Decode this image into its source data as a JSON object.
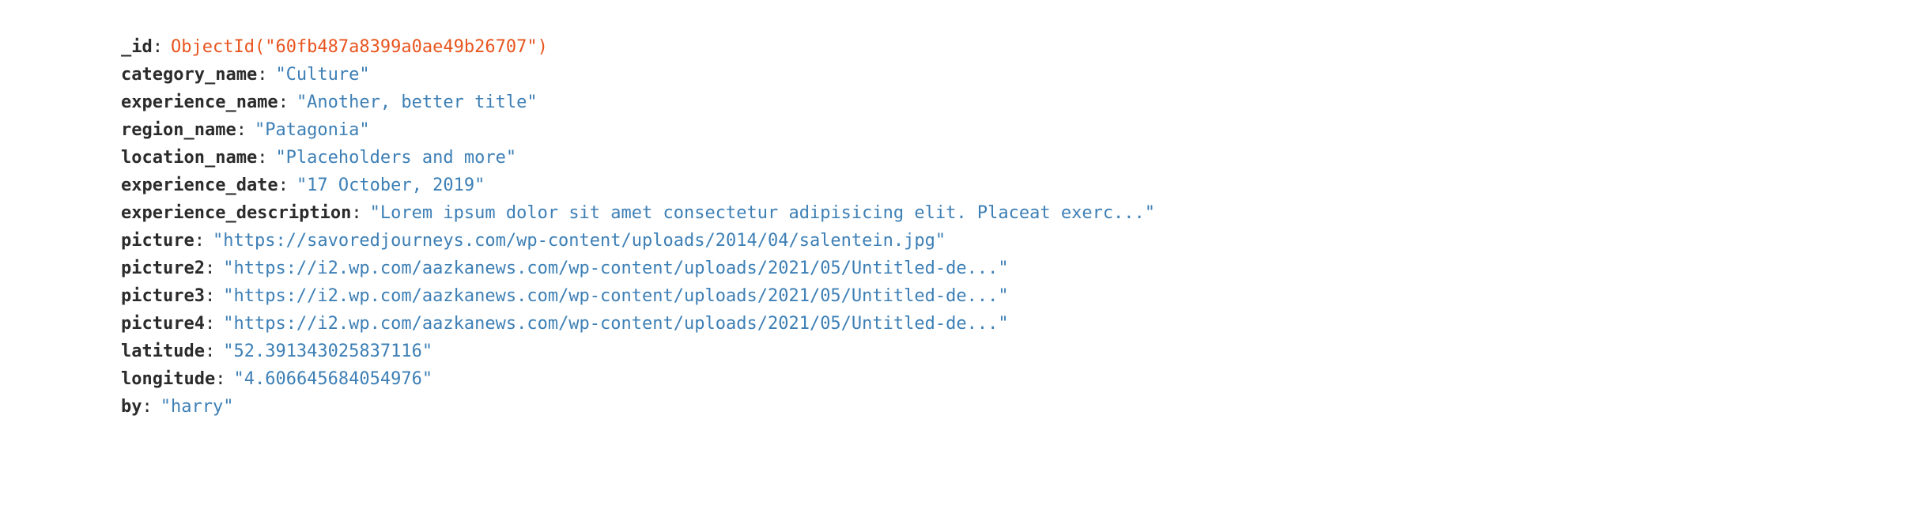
{
  "document": {
    "fields": [
      {
        "key": "_id",
        "value": "ObjectId(\"60fb487a8399a0ae49b26707\")",
        "type": "objectid"
      },
      {
        "key": "category_name",
        "value": "\"Culture\"",
        "type": "string"
      },
      {
        "key": "experience_name",
        "value": "\"Another, better title\"",
        "type": "string"
      },
      {
        "key": "region_name",
        "value": "\"Patagonia\"",
        "type": "string"
      },
      {
        "key": "location_name",
        "value": "\"Placeholders and more\"",
        "type": "string"
      },
      {
        "key": "experience_date",
        "value": "\"17 October, 2019\"",
        "type": "string"
      },
      {
        "key": "experience_description",
        "value": "\"Lorem ipsum dolor sit amet consectetur adipisicing elit. Placeat exerc...\"",
        "type": "string"
      },
      {
        "key": "picture",
        "value": "\"https://savoredjourneys.com/wp-content/uploads/2014/04/salentein.jpg\"",
        "type": "string"
      },
      {
        "key": "picture2",
        "value": "\"https://i2.wp.com/aazkanews.com/wp-content/uploads/2021/05/Untitled-de...\"",
        "type": "string"
      },
      {
        "key": "picture3",
        "value": "\"https://i2.wp.com/aazkanews.com/wp-content/uploads/2021/05/Untitled-de...\"",
        "type": "string"
      },
      {
        "key": "picture4",
        "value": "\"https://i2.wp.com/aazkanews.com/wp-content/uploads/2021/05/Untitled-de...\"",
        "type": "string"
      },
      {
        "key": "latitude",
        "value": "\"52.391343025837116\"",
        "type": "string"
      },
      {
        "key": "longitude",
        "value": "\"4.606645684054976\"",
        "type": "string"
      },
      {
        "key": "by",
        "value": "\"harry\"",
        "type": "string"
      }
    ],
    "colors": {
      "key": "#2b2b2b",
      "string_value": "#3d7fb5",
      "objectid_value": "#e8551f"
    }
  }
}
